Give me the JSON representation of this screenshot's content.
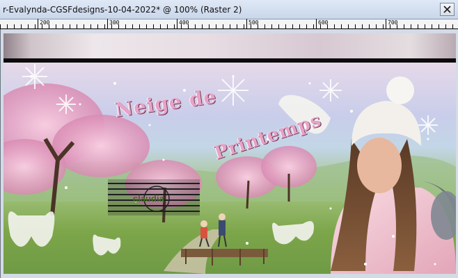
{
  "window": {
    "title": "r-Evalynda-CGSFdesigns-10-04-2022* @ 100% (Raster 2)"
  },
  "ruler": {
    "labels": [
      "200",
      "300",
      "400",
      "500",
      "600",
      "700"
    ]
  },
  "artwork": {
    "title_line1": "Neige de",
    "title_line2": "Printemps",
    "watermark": "claudia"
  },
  "colors": {
    "titlebar": "#d8e2f2",
    "title_pink": "#e9a9c8",
    "coat": "#f2c7d2"
  },
  "icons": {
    "close": "close-icon"
  }
}
